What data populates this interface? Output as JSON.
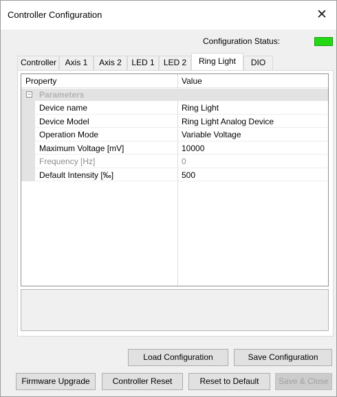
{
  "window": {
    "title": "Controller Configuration",
    "close_glyph": "✕"
  },
  "status": {
    "label": "Configuration Status:",
    "color": "#22d914"
  },
  "tabs": [
    {
      "label": "Controller",
      "active": false
    },
    {
      "label": "Axis 1",
      "active": false
    },
    {
      "label": "Axis 2",
      "active": false
    },
    {
      "label": "LED 1",
      "active": false
    },
    {
      "label": "LED 2",
      "active": false
    },
    {
      "label": "Ring Light",
      "active": true
    },
    {
      "label": "DIO",
      "active": false
    }
  ],
  "grid": {
    "headers": {
      "property": "Property",
      "value": "Value"
    },
    "category": {
      "label": "Parameters",
      "toggle": "−"
    },
    "rows": [
      {
        "name": "Device name",
        "value": "Ring Light",
        "enabled": true
      },
      {
        "name": "Device Model",
        "value": "Ring Light Analog Device",
        "enabled": true
      },
      {
        "name": "Operation Mode",
        "value": "Variable Voltage",
        "enabled": true
      },
      {
        "name": "Maximum Voltage [mV]",
        "value": "10000",
        "enabled": true
      },
      {
        "name": "Frequency [Hz]",
        "value": "0",
        "enabled": false
      },
      {
        "name": "Default Intensity [‰]",
        "value": "500",
        "enabled": true
      }
    ]
  },
  "buttons": {
    "load": "Load Configuration",
    "save": "Save Configuration",
    "firmware": "Firmware Upgrade",
    "reset": "Controller Reset",
    "default": "Reset to Default",
    "save_close": "Save & Close"
  }
}
